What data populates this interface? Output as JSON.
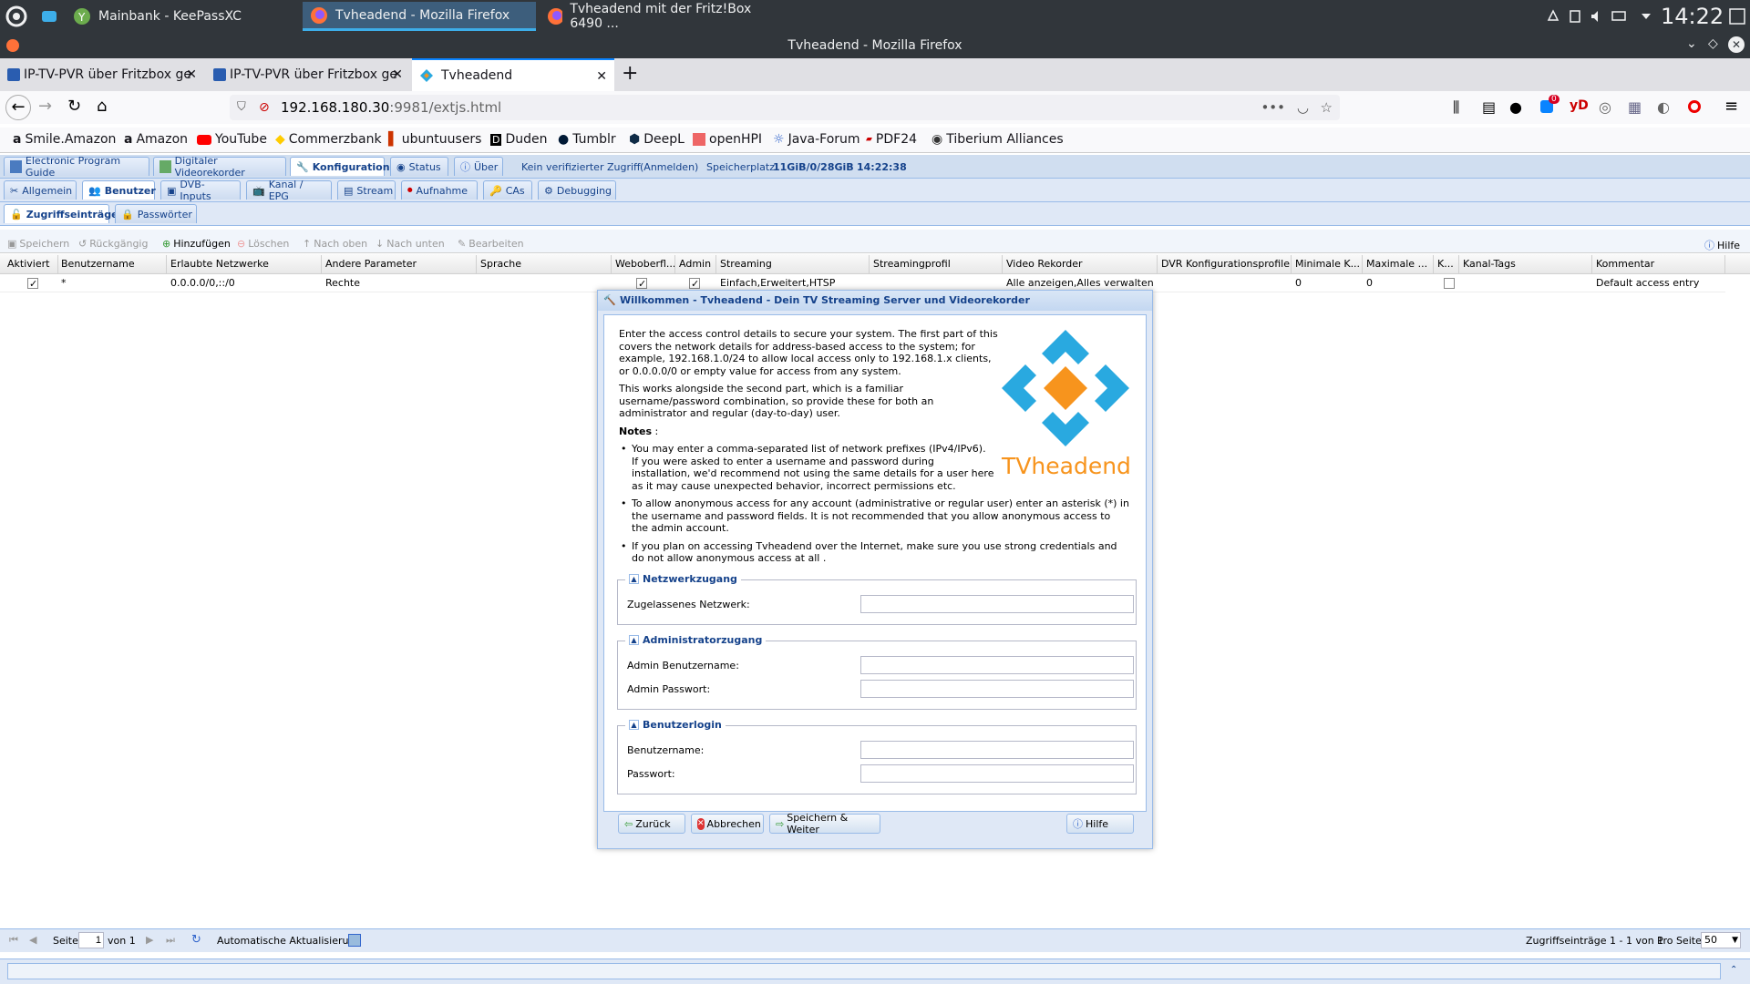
{
  "taskbar": {
    "tasks": [
      {
        "label": "Mainbank - KeePassXC"
      },
      {
        "label": "Tvheadend - Mozilla Firefox"
      },
      {
        "label": "Tvheadend mit der Fritz!Box 6490 ..."
      }
    ],
    "clock": "14:22"
  },
  "firefox": {
    "window_title": "Tvheadend - Mozilla Firefox",
    "tabs": [
      {
        "label": "IP-TV-PVR über Fritzbox ge"
      },
      {
        "label": "IP-TV-PVR über Fritzbox ge"
      },
      {
        "label": "Tvheadend"
      }
    ],
    "url_host": "192.168.180.30",
    "url_rest": ":9981/extjs.html",
    "sync_badge": "0",
    "bookmarks": [
      "Smile.Amazon",
      "Amazon",
      "YouTube",
      "Commerzbank",
      "ubuntuusers",
      "Duden",
      "Tumblr",
      "DeepL",
      "openHPI",
      "Java-Forum",
      "PDF24",
      "Tiberium Alliances"
    ]
  },
  "tvh": {
    "main_tabs": [
      "Electronic Program Guide",
      "Digitaler Videorekorder",
      "Konfiguration",
      "Status",
      "Über"
    ],
    "info": {
      "access": "Kein verifizierter Zugriff",
      "login": "(Anmelden)",
      "storage_label": "Speicherplatz:",
      "storage_value": "11GiB/0/28GiB",
      "time": "14:22:38"
    },
    "sub_tabs": [
      "Allgemein",
      "Benutzer",
      "DVB-Inputs",
      "Kanal / EPG",
      "Stream",
      "Aufnahme",
      "CAs",
      "Debugging"
    ],
    "third_tabs": [
      "Zugriffseinträge",
      "Passwörter"
    ],
    "toolbar": [
      "Speichern",
      "Rückgängig",
      "Hinzufügen",
      "Löschen",
      "Nach oben",
      "Nach unten",
      "Bearbeiten"
    ],
    "help": "Hilfe",
    "columns": [
      "Aktiviert",
      "Benutzername",
      "Erlaubte Netzwerke",
      "Andere Parameter",
      "Sprache",
      "Weboberfl...",
      "Admin",
      "Streaming",
      "Streamingprofil",
      "Video Rekorder",
      "DVR Konfigurationsprofile",
      "Minimale K...",
      "Maximale ...",
      "K...",
      "Kanal-Tags",
      "Kommentar"
    ],
    "row": {
      "username": "*",
      "networks": "0.0.0.0/0,::/0",
      "other": "Rechte",
      "streaming": "Einfach,Erweitert,HTSP",
      "recorder": "Alle anzeigen,Alles verwalten,...",
      "min": "0",
      "max": "0",
      "comment": "Default access entry"
    },
    "pager": {
      "page_label": "Seite",
      "page_value": "1",
      "of_label": "von 1",
      "auto_refresh": "Automatische Aktualisierung",
      "summary": "Zugriffseinträge 1 - 1 von 1",
      "per_page_label": "Pro Seite",
      "per_page_value": "50"
    }
  },
  "dialog": {
    "title": "Willkommen - Tvheadend - Dein TV Streaming Server und Videorekorder",
    "para1": "Enter the access control details to secure your system. The first part of this covers the network details for address-based access to the system; for example, 192.168.1.0/24 to allow local access only to 192.168.1.x clients, or 0.0.0.0/0 or empty value for access from any system.",
    "para2": "This works alongside the second part, which is a familiar username/password combination, so provide these for both an administrator and regular (day-to-day) user.",
    "notes_label": "Notes",
    "notes_colon": " :",
    "notes": [
      "You may enter a comma-separated list of network prefixes (IPv4/IPv6). If you were asked to enter a username and password during installation, we'd recommend not using the same details for a user here as it may cause unexpected behavior, incorrect permissions etc.",
      "To allow anonymous access for any account (administrative or regular user) enter an asterisk (*) in the username and password fields. It is not recommended that you allow anonymous access to the admin account.",
      "If you plan on accessing Tvheadend over the Internet, make sure you use strong credentials and do not allow anonymous access at all ."
    ],
    "logo_text": "TVheadend",
    "sections": {
      "network": {
        "legend": "Netzwerkzugang",
        "field": "Zugelassenes Netzwerk:"
      },
      "admin": {
        "legend": "Administratorzugang",
        "user": "Admin Benutzername:",
        "pass": "Admin Passwort:"
      },
      "user": {
        "legend": "Benutzerlogin",
        "user": "Benutzername:",
        "pass": "Passwort:"
      }
    },
    "buttons": {
      "back": "Zurück",
      "cancel": "Abbrechen",
      "save": "Speichern & Weiter",
      "help": "Hilfe"
    }
  },
  "colors": {
    "tvh_blue": "#15428b",
    "logo_blue": "#29a9e0",
    "logo_orange": "#f7941d"
  }
}
